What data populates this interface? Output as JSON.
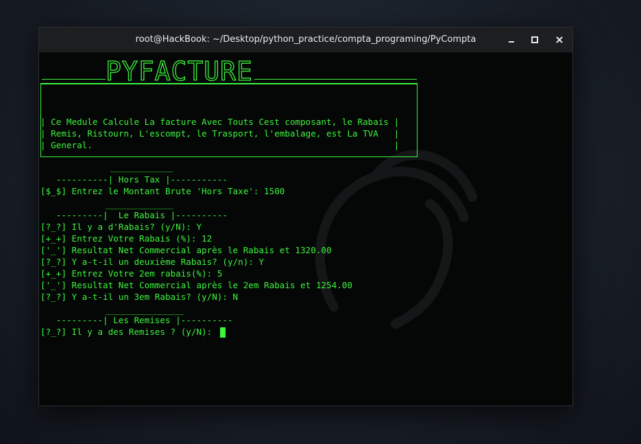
{
  "window": {
    "title": "root@HackBook: ~/Desktop/python_practice/compta_programing/PyCompta"
  },
  "banner": {
    "logo": "PYFACTURE",
    "desc_lines": [
      "| Ce Medule Calcule La facture Avec Touts Cest composant, le Rabais |",
      "| Remis, Ristourn, L'escompt, le Trasport, l'embalage, est La TVA   |",
      "| General.                                                          |"
    ]
  },
  "sections": {
    "hors_tax": {
      "underline": "____________",
      "header": "   ----------| Hors Tax |-----------"
    },
    "rabais": {
      "underline": "_____________",
      "header": "   ---------|  Le Rabais |----------"
    },
    "remises": {
      "underline": "_______________",
      "header": "   ---------| Les Remises |----------"
    }
  },
  "lines": {
    "montant": "[$_$] Entrez le Montant Brute 'Hors Taxe': 1500",
    "rabais_q": "[?_?] Il y a d'Rabais? (y/N): Y",
    "rabais_in": "[+_+] Entrez Votre Rabais (%): 12",
    "rabais_res": "['_'] Resultat Net Commercial après le Rabais et 1320.00",
    "rabais2_q": "[?_?] Y a-t-il un deuxième Rabais? (y/n): Y",
    "rabais2_in": "[+_+] Entrez Votre 2em rabais(%): 5",
    "rabais2_res": "['_'] Resultat Net Commercial après le 2em Rabais et 1254.00",
    "rabais3_q": "[?_?] Y a-t-il un 3em Rabais? (y/N): N",
    "remises_q": "[?_?] Il y a des Remises ? (y/N): "
  },
  "colors": {
    "terminal_fg": "#3df53d",
    "terminal_bg": "#050606",
    "titlebar_bg": "#1c1e20"
  }
}
